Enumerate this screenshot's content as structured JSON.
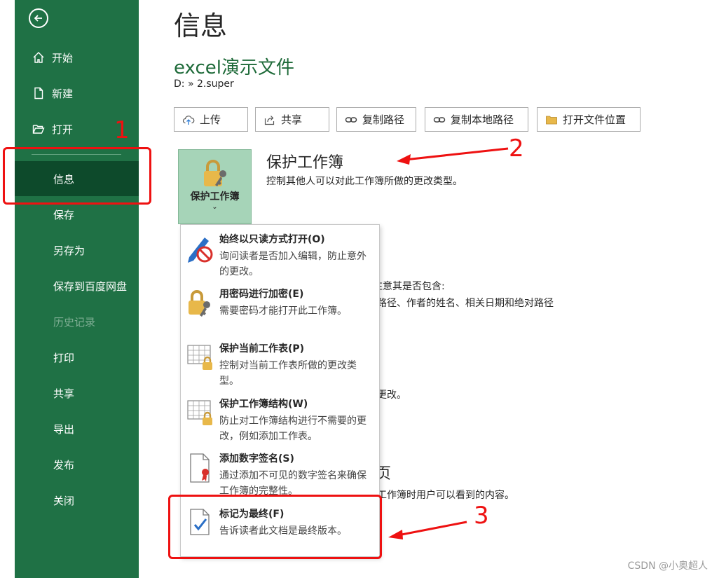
{
  "sidebar": {
    "items": [
      {
        "label": "开始",
        "icon": "home-icon"
      },
      {
        "label": "新建",
        "icon": "new-document-icon"
      },
      {
        "label": "打开",
        "icon": "open-folder-icon"
      },
      {
        "label": "信息"
      },
      {
        "label": "保存"
      },
      {
        "label": "另存为"
      },
      {
        "label": "保存到百度网盘"
      },
      {
        "label": "历史记录"
      },
      {
        "label": "打印"
      },
      {
        "label": "共享"
      },
      {
        "label": "导出"
      },
      {
        "label": "发布"
      },
      {
        "label": "关闭"
      }
    ],
    "selected_index": 3,
    "accent": "#1f7145",
    "selected_color": "#0d4a2b"
  },
  "page": {
    "title": "信息",
    "file_name": "excel演示文件",
    "file_path": "D: » 2.super"
  },
  "toolbar": {
    "upload": "上传",
    "share": "共享",
    "copy_path": "复制路径",
    "copy_local_path": "复制本地路径",
    "open_location": "打开文件位置"
  },
  "protect": {
    "tile_label": "保护工作簿",
    "tile_chevron": "⌄",
    "title": "保护工作簿",
    "description": "控制其他人可以对此工作簿所做的更改类型。"
  },
  "background_text": {
    "inspect_line1": "注意其是否包含:",
    "inspect_line2": "路径、作者的姓名、相关日期和绝对路径",
    "versions_fragment": "更改。",
    "browser_heading_fragment": "页",
    "browser_desc_fragment": "工作簿时用户可以看到的内容。"
  },
  "dropdown": {
    "items": [
      {
        "title": "始终以只读方式打开(O)",
        "desc": "询问读者是否加入编辑，防止意外的更改。",
        "icon": "pencil-no-edit-icon"
      },
      {
        "title": "用密码进行加密(E)",
        "desc": "需要密码才能打开此工作簿。",
        "icon": "lock-key-icon"
      },
      {
        "title": "保护当前工作表(P)",
        "desc": "控制对当前工作表所做的更改类型。",
        "icon": "sheet-lock-icon"
      },
      {
        "title": "保护工作簿结构(W)",
        "desc": "防止对工作簿结构进行不需要的更改，例如添加工作表。",
        "icon": "workbook-lock-icon"
      },
      {
        "title": "添加数字签名(S)",
        "desc": "通过添加不可见的数字签名来确保工作簿的完整性。",
        "icon": "signature-ribbon-icon"
      },
      {
        "title": "标记为最终(F)",
        "desc": "告诉读者此文档是最终版本。",
        "icon": "mark-final-icon"
      }
    ]
  },
  "annotations": {
    "one": "1",
    "two": "2",
    "three": "3",
    "color": "#ee1111"
  },
  "watermark": "CSDN @小奥超人"
}
